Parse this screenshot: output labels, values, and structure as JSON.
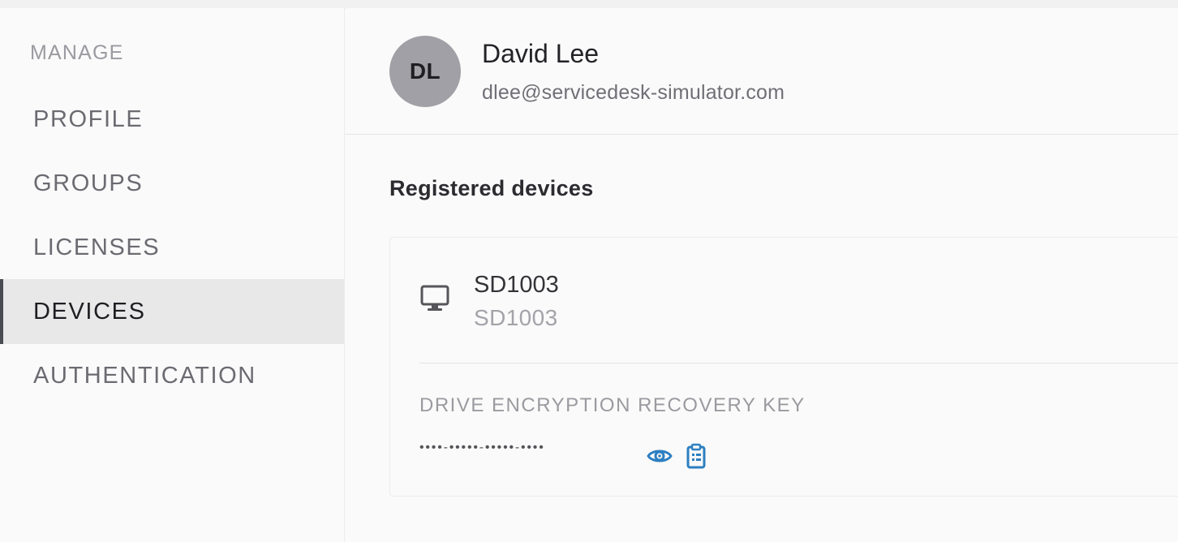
{
  "sidebar": {
    "heading": "MANAGE",
    "items": [
      {
        "label": "PROFILE",
        "active": false
      },
      {
        "label": "GROUPS",
        "active": false
      },
      {
        "label": "LICENSES",
        "active": false
      },
      {
        "label": "DEVICES",
        "active": true
      },
      {
        "label": "AUTHENTICATION",
        "active": false
      }
    ]
  },
  "user": {
    "initials": "DL",
    "name": "David Lee",
    "email": "dlee@servicedesk-simulator.com"
  },
  "main": {
    "section_title": "Registered devices",
    "devices": [
      {
        "icon": "desktop-monitor-icon",
        "name": "SD1003",
        "subname": "SD1003",
        "key_label": "DRIVE ENCRYPTION RECOVERY KEY",
        "masked_key": "••••-•••••-•••••-••••"
      }
    ]
  },
  "colors": {
    "accent": "#2d7fc1",
    "active_nav_bg": "#e8e8e9",
    "avatar_bg": "#a0a0a6"
  }
}
